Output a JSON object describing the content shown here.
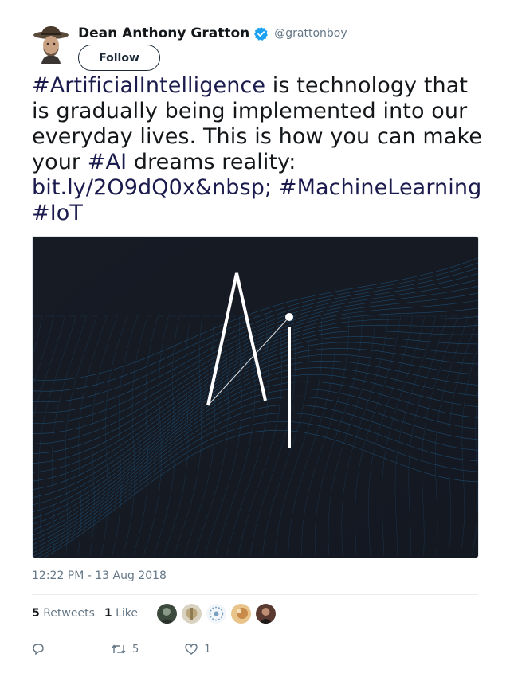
{
  "colors": {
    "link": "#1b1b4d",
    "verified": "#1da1f2",
    "text": "#14171a",
    "muted": "#657786",
    "media_bg": "#171a22"
  },
  "author": {
    "display_name": "Dean Anthony Gratton",
    "handle": "@grattonboy",
    "verified": true,
    "avatar": "avatar-man-with-fedora",
    "follow_label": "Follow"
  },
  "tweet": {
    "text_segments": [
      {
        "type": "hashtag",
        "text": "#ArtificialIntelligence"
      },
      {
        "type": "text",
        "text": " is technology that is gradually being implemented into our everyday lives. This is how you can make your "
      },
      {
        "type": "hashtag",
        "text": "#AI"
      },
      {
        "type": "text",
        "text": " dreams reality: "
      },
      {
        "type": "link",
        "text": "bit.ly/2O9dQ0x&nbsp;"
      },
      {
        "type": "text",
        "text": " "
      },
      {
        "type": "hashtag",
        "text": "#MachineLearning"
      },
      {
        "type": "text",
        "text": " "
      },
      {
        "type": "hashtag",
        "text": "#IoT"
      }
    ],
    "media": {
      "description_icon": "ai-logo-image",
      "logo_text": "AI"
    },
    "timestamp": "12:22 PM - 13 Aug 2018"
  },
  "stats": {
    "retweets_count": "5",
    "retweets_label": "Retweets",
    "likes_count": "1",
    "likes_label": "Like",
    "likers": [
      "liker-avatar-1",
      "liker-avatar-2",
      "liker-avatar-3",
      "liker-avatar-4",
      "liker-avatar-5"
    ]
  },
  "actions": {
    "reply_count": "",
    "retweet_count": "5",
    "like_count": "1"
  }
}
